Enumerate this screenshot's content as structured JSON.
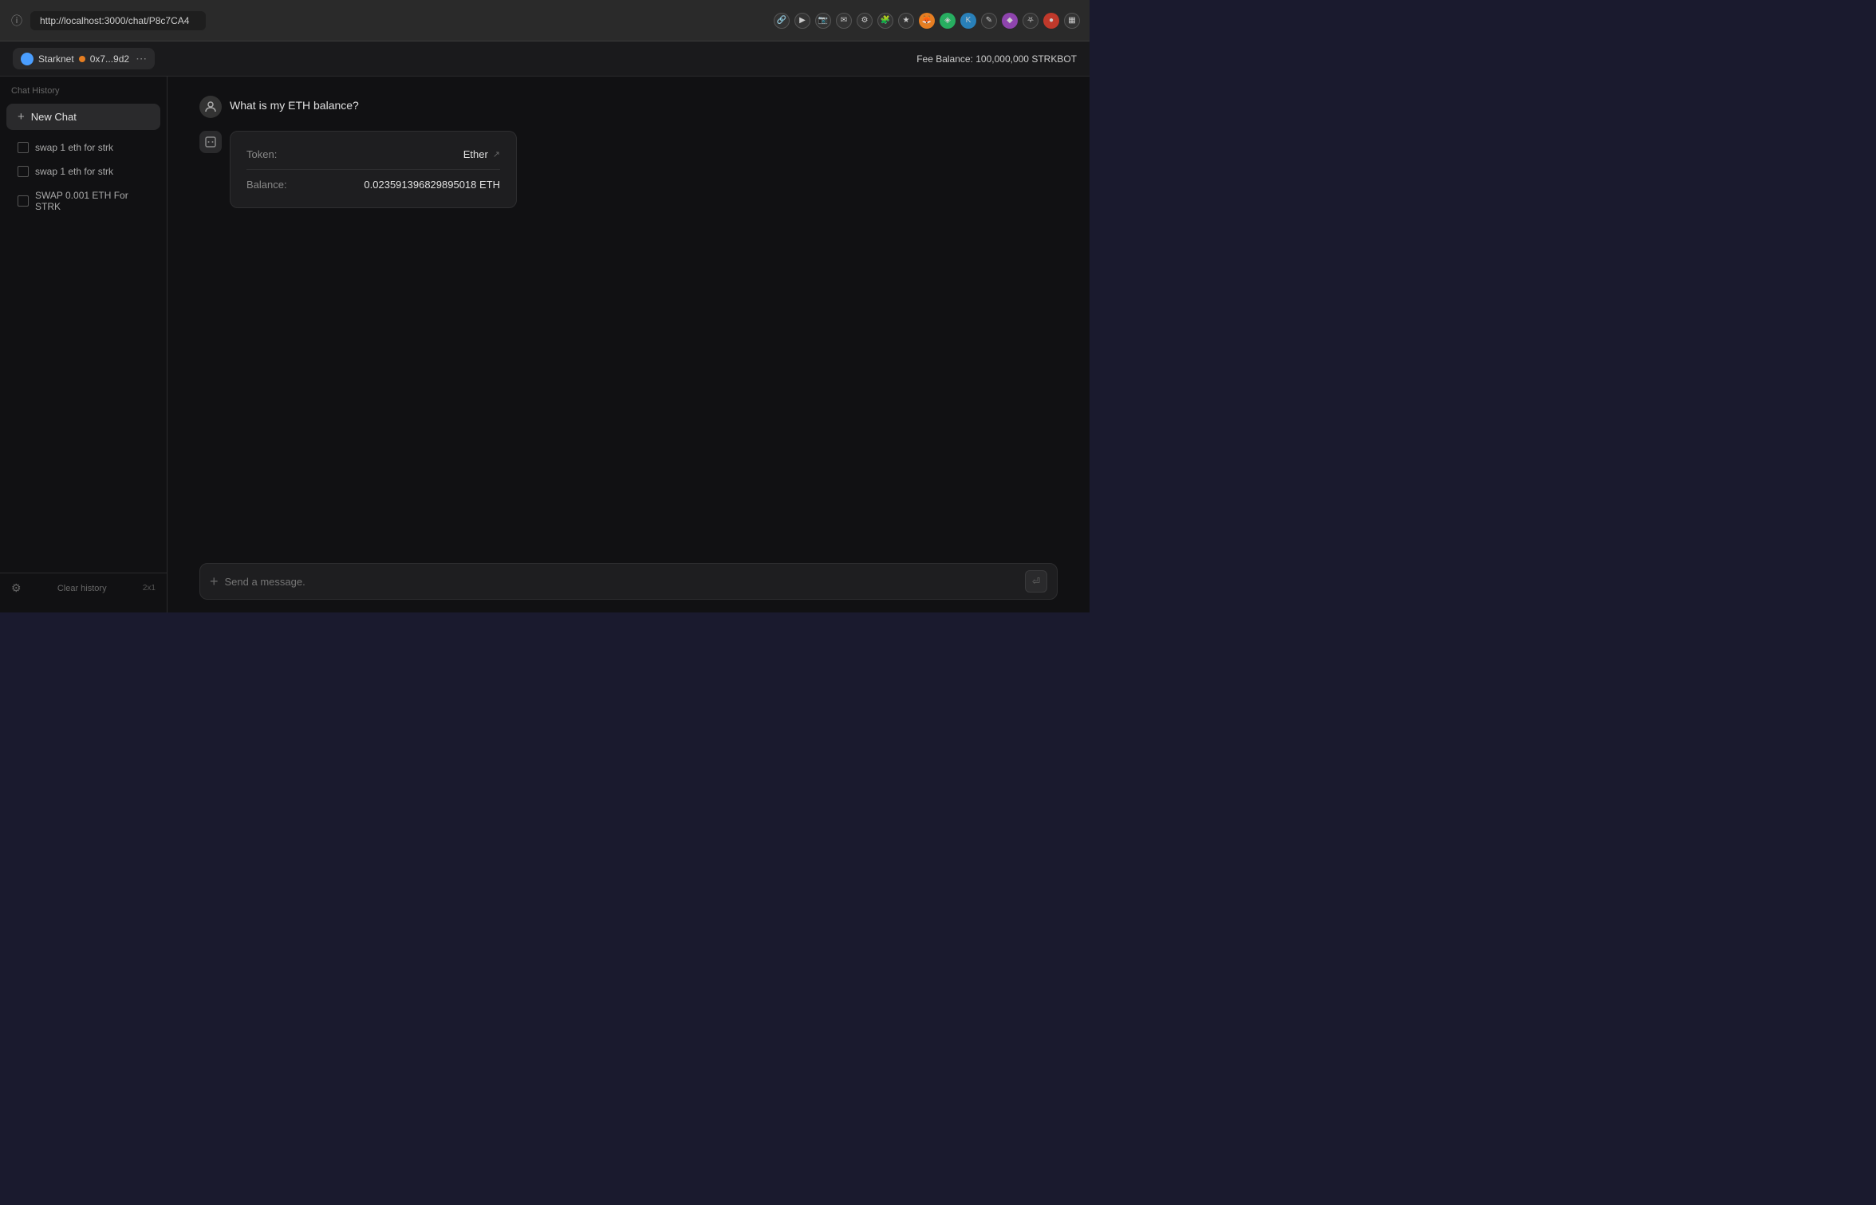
{
  "browser": {
    "url": "http://localhost:3000/chat/P8c7CA4",
    "info_icon": "ⓘ"
  },
  "topbar": {
    "network_label": "Starknet",
    "wallet_label": "0x7...9d2",
    "fee_balance_label": "Fee Balance:",
    "fee_balance_value": "100,000,000 STRKBOT"
  },
  "sidebar": {
    "header_label": "Chat History",
    "new_chat_label": "New Chat",
    "history_items": [
      {
        "label": "swap 1 eth for strk"
      },
      {
        "label": "swap 1 eth for strk"
      },
      {
        "label": "SWAP 0.001 ETH For STRK"
      }
    ],
    "clear_history_label": "Clear history",
    "zoom_label": "2x1"
  },
  "chat": {
    "user_message": "What is my ETH balance?",
    "balance_card": {
      "token_label": "Token:",
      "token_value": "Ether",
      "balance_label": "Balance:",
      "balance_value": "0.023591396829895018 ETH"
    },
    "input_placeholder": "Send a message."
  }
}
